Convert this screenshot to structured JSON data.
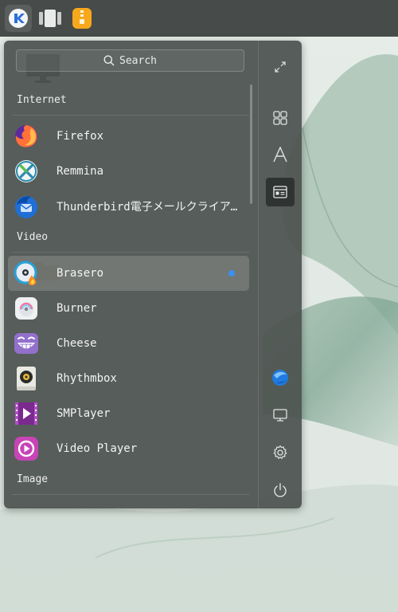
{
  "panel": {
    "icons": [
      "launcher-icon",
      "window-switcher-icon",
      "archive-manager-icon"
    ]
  },
  "desktop": {
    "icons": [
      "computer-icon",
      "folder-icon",
      "trash-icon"
    ]
  },
  "search": {
    "label": "Search"
  },
  "menu": {
    "categories": [
      {
        "label": "Internet",
        "items": [
          {
            "label": "Firefox",
            "icon": "firefox-icon"
          },
          {
            "label": "Remmina",
            "icon": "remmina-icon"
          },
          {
            "label": "Thunderbird電子メールクライア…",
            "icon": "thunderbird-icon"
          }
        ]
      },
      {
        "label": "Video",
        "items": [
          {
            "label": "Brasero",
            "icon": "brasero-icon"
          },
          {
            "label": "Burner",
            "icon": "burner-icon"
          },
          {
            "label": "Cheese",
            "icon": "cheese-icon"
          },
          {
            "label": "Rhythmbox",
            "icon": "rhythmbox-icon"
          },
          {
            "label": "SMPlayer",
            "icon": "smplayer-icon"
          },
          {
            "label": "Video Player",
            "icon": "video-player-icon"
          }
        ]
      },
      {
        "label": "Image",
        "items": []
      }
    ],
    "selected_item": "Brasero"
  },
  "sidebar": {
    "buttons": [
      "fullscreen-icon",
      "category-view-icon",
      "letter-sort-icon",
      "function-view-icon",
      "browser-icon",
      "display-icon",
      "settings-icon",
      "power-icon"
    ],
    "active": "function-view-icon"
  },
  "colors": {
    "accent": "#3a8ff0",
    "panel": "#474b49",
    "menu_bg": "#4e5451"
  }
}
